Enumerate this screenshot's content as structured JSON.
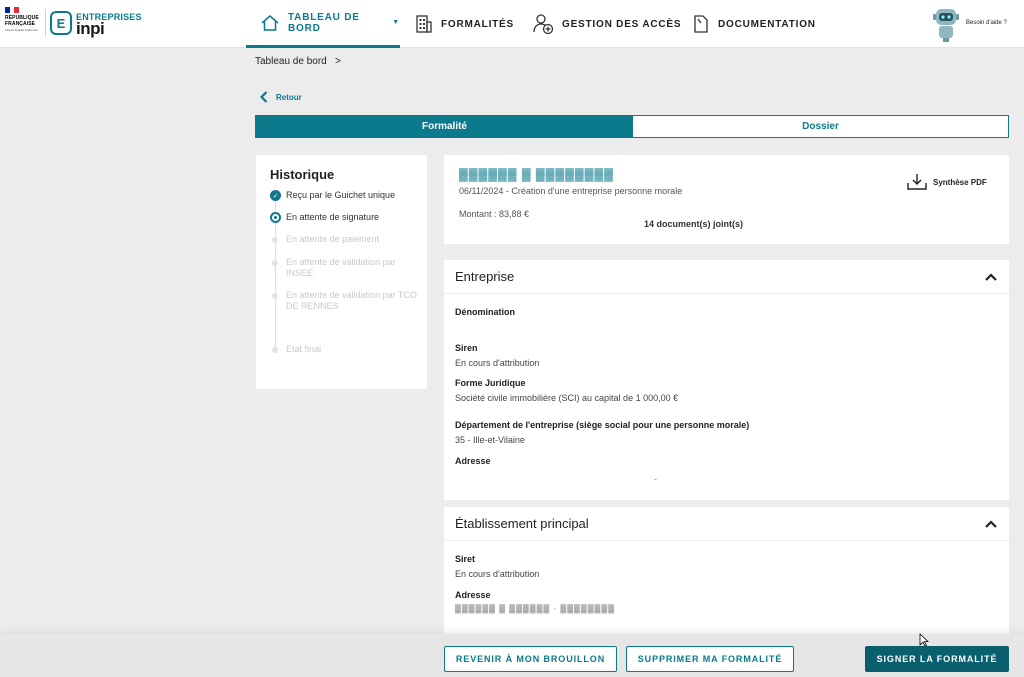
{
  "header": {
    "gov_logo": {
      "line1": "RÉPUBLIQUE",
      "line2": "FRANÇAISE",
      "motto": "Liberté Égalité Fraternité"
    },
    "brand": {
      "initial": "E",
      "name": "ENTREPRISES",
      "sub": "inpi"
    },
    "nav": [
      {
        "label": "TABLEAU DE BORD",
        "icon": "home-icon",
        "active": true
      },
      {
        "label": "FORMALITÉS",
        "icon": "building-icon",
        "active": false
      },
      {
        "label": "GESTION DES ACCÈS",
        "icon": "user-add-icon",
        "active": false
      },
      {
        "label": "DOCUMENTATION",
        "icon": "document-icon",
        "active": false
      }
    ],
    "help_label": "Besoin d'aide ?"
  },
  "breadcrumb": "Tableau de bord",
  "back_label": "Retour",
  "tabs": [
    {
      "label": "Formalité",
      "active": true
    },
    {
      "label": "Dossier",
      "active": false
    }
  ],
  "history": {
    "title": "Historique",
    "steps": [
      {
        "label": "Reçu par le Guichet unique",
        "state": "done"
      },
      {
        "label": "En attente de signature",
        "state": "current"
      },
      {
        "label": "En attente de paiement",
        "state": "future"
      },
      {
        "label": "En attente de validation par INSEE",
        "state": "future"
      },
      {
        "label": "En attente de validation par TCO DE RENNES",
        "state": "future"
      },
      {
        "label": "Etat final",
        "state": "future"
      }
    ]
  },
  "summary": {
    "name_blurred": "▓▓▓▓▓▓ ▓ ▓▓▓▓▓▓▓▓",
    "date_line": "06/11/2024 - Création d'une entreprise personne morale",
    "amount": "Montant : 83,88 €",
    "documents": "14 document(s) joint(s)",
    "pdf_label": "Synthèse PDF"
  },
  "entreprise": {
    "title": "Entreprise",
    "fields": {
      "denomination_label": "Dénomination",
      "siren_label": "Siren",
      "siren_value": "En cours d'attribution",
      "forme_label": "Forme Juridique",
      "forme_value": "Société civile immobilière (SCI) au capital de 1 000,00 €",
      "departement_label": "Département de l'entreprise (siège social pour une personne morale)",
      "departement_value": "35 - Ille-et-Vilaine",
      "adresse_label": "Adresse",
      "adresse_value": "-"
    }
  },
  "etablissement": {
    "title": "Établissement principal",
    "fields": {
      "siret_label": "Siret",
      "siret_value": "En cours d'attribution",
      "adresse_label": "Adresse",
      "adresse_blurred": "▓▓▓▓▓▓ ▓ ▓▓▓▓▓▓ - ▓▓▓▓▓▓▓▓"
    }
  },
  "actions": {
    "back_draft": "REVENIR À MON BROUILLON",
    "delete": "SUPPRIMER MA FORMALITÉ",
    "sign": "SIGNER LA FORMALITÉ"
  },
  "colors": {
    "accent": "#0a7a8c",
    "accent_dark": "#0a5f6e",
    "background": "#ececec"
  }
}
